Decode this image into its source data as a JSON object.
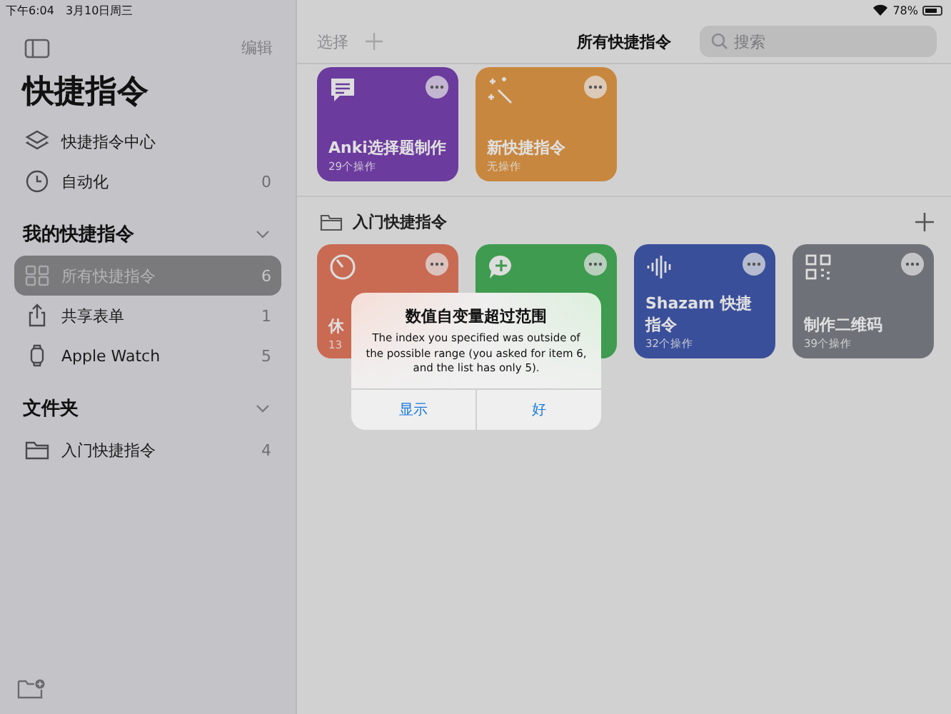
{
  "status_bar": {
    "time": "下午6:04",
    "date": "3月10日周三",
    "battery_text": "78%"
  },
  "sidebar": {
    "edit": "编辑",
    "title": "快捷指令",
    "top_items": [
      {
        "label": "快捷指令中心"
      },
      {
        "label": "自动化",
        "count": "0"
      }
    ],
    "sections": [
      {
        "title": "我的快捷指令",
        "expanded": true,
        "items": [
          {
            "label": "所有快捷指令",
            "count": "6",
            "selected": true
          },
          {
            "label": "共享表单",
            "count": "1",
            "selected": false
          },
          {
            "label": "Apple Watch",
            "count": "5",
            "selected": false
          }
        ]
      },
      {
        "title": "文件夹",
        "expanded": true,
        "items": [
          {
            "label": "入门快捷指令",
            "count": "4",
            "selected": false
          }
        ]
      }
    ]
  },
  "toolbar": {
    "select": "选择",
    "title": "所有快捷指令",
    "search": {
      "placeholder": "搜索"
    }
  },
  "top_cards": [
    {
      "title": "Anki选择题制作",
      "subtitle": "29个操作",
      "color": "#6c3b9e"
    },
    {
      "title": "新快捷指令",
      "subtitle": "无操作",
      "color": "#c8873e"
    }
  ],
  "folder": {
    "title": "入门快捷指令",
    "cards": [
      {
        "title": "休",
        "subtitle": "13",
        "color": "#c96a53"
      },
      {
        "color": "#3f9b4f"
      },
      {
        "title": "Shazam 快捷指令",
        "subtitle": "32个操作",
        "color": "#3a4f9a"
      },
      {
        "title": "制作二维码",
        "subtitle": "39个操作",
        "color": "#6e7278"
      }
    ]
  },
  "alert": {
    "title": "数值自变量超过范围",
    "message": "The index you specified was outside of the possible range (you asked for item 6, and the list has only 5).",
    "buttons": [
      "显示",
      "好"
    ]
  }
}
